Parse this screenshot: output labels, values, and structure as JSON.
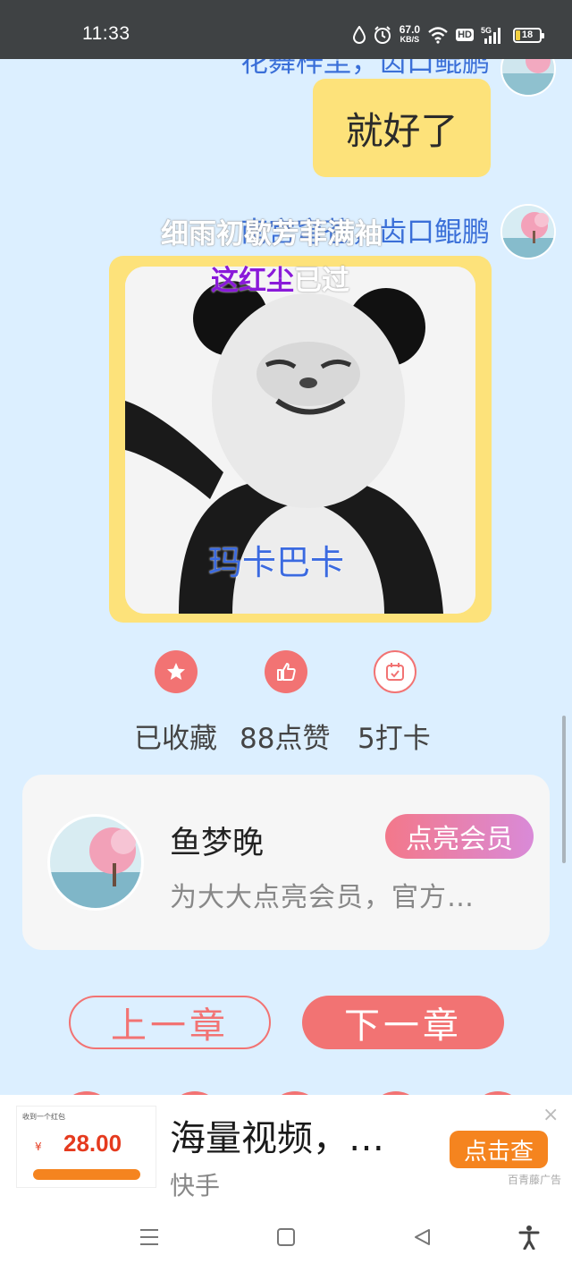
{
  "status_bar": {
    "time": "11:33",
    "net_speed_value": "67.0",
    "net_speed_unit": "KB/S",
    "hd": "HD",
    "signal_label": "5G",
    "battery": "18"
  },
  "chat": {
    "partial_name": "花舞梓尘，齿口鲲鹏",
    "bubble_text": "就好了",
    "sender_name": "南宫穹苍，齿口鲲鹏",
    "danmu_top": "细雨初歇芳菲满袖",
    "danmu_mid_part1": "这红尘",
    "danmu_mid_part2": "已过",
    "danmu_bottom": "玛卡巴卡"
  },
  "actions": {
    "favorite_stat": "已收藏",
    "like_stat": "88点赞",
    "checkin_stat": "5打卡"
  },
  "member_card": {
    "name": "鱼梦晚",
    "description": "为大大点亮会员，官方…",
    "button_label": "点亮会员"
  },
  "chapter_nav": {
    "prev_label": "上一章",
    "next_label": "下一章"
  },
  "ad": {
    "thumb_header": "收到一个红包",
    "thumb_currency": "¥",
    "thumb_amount": "28.00",
    "title": "海量视频，…",
    "source": "快手",
    "cta_label": "点击查",
    "ad_label": "百青藤广告",
    "close_glyph": "×"
  },
  "colors": {
    "accent": "#f27373",
    "bubble": "#fde27a",
    "background": "#dcefff",
    "name_blue": "#3a6fd8"
  }
}
